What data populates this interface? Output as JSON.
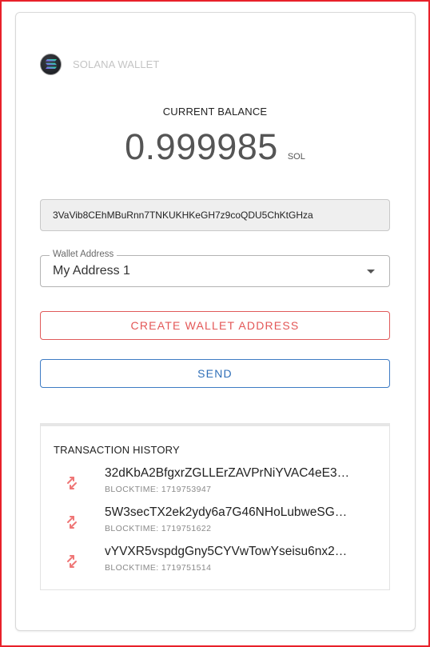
{
  "app": {
    "brand_name": "SOLANA WALLET",
    "brand_icon": "solana-logo-icon"
  },
  "balance": {
    "label": "CURRENT BALANCE",
    "value": "0.999985",
    "unit": "SOL"
  },
  "address": {
    "current": "3VaVib8CEhMBuRnn7TNKUKHKeGH7z9coQDU5ChKtGHza"
  },
  "wallet_select": {
    "legend": "Wallet Address",
    "value": "My Address 1"
  },
  "actions": {
    "create_label": "CREATE WALLET ADDRESS",
    "send_label": "SEND"
  },
  "history": {
    "title": "TRANSACTION HISTORY",
    "items": [
      {
        "signature": "32dKbA2BfgxrZGLLErZAVPrNiYVAC4eE3…",
        "blocktime": "BLOCKTIME: 1719753947",
        "icon": "transfer-arrows-icon"
      },
      {
        "signature": "5W3secTX2ek2ydy6a7G46NHoLubweSG…",
        "blocktime": "BLOCKTIME: 1719751622",
        "icon": "transfer-arrows-icon"
      },
      {
        "signature": "vYVXR5vspdgGny5CYVwTowYseisu6nx2…",
        "blocktime": "BLOCKTIME: 1719751514",
        "icon": "transfer-arrows-icon"
      }
    ]
  },
  "colors": {
    "outline_red": "#e8212a",
    "create_button": "#e35757",
    "send_button": "#2f6fb8",
    "tx_icon": "#ef7676"
  }
}
